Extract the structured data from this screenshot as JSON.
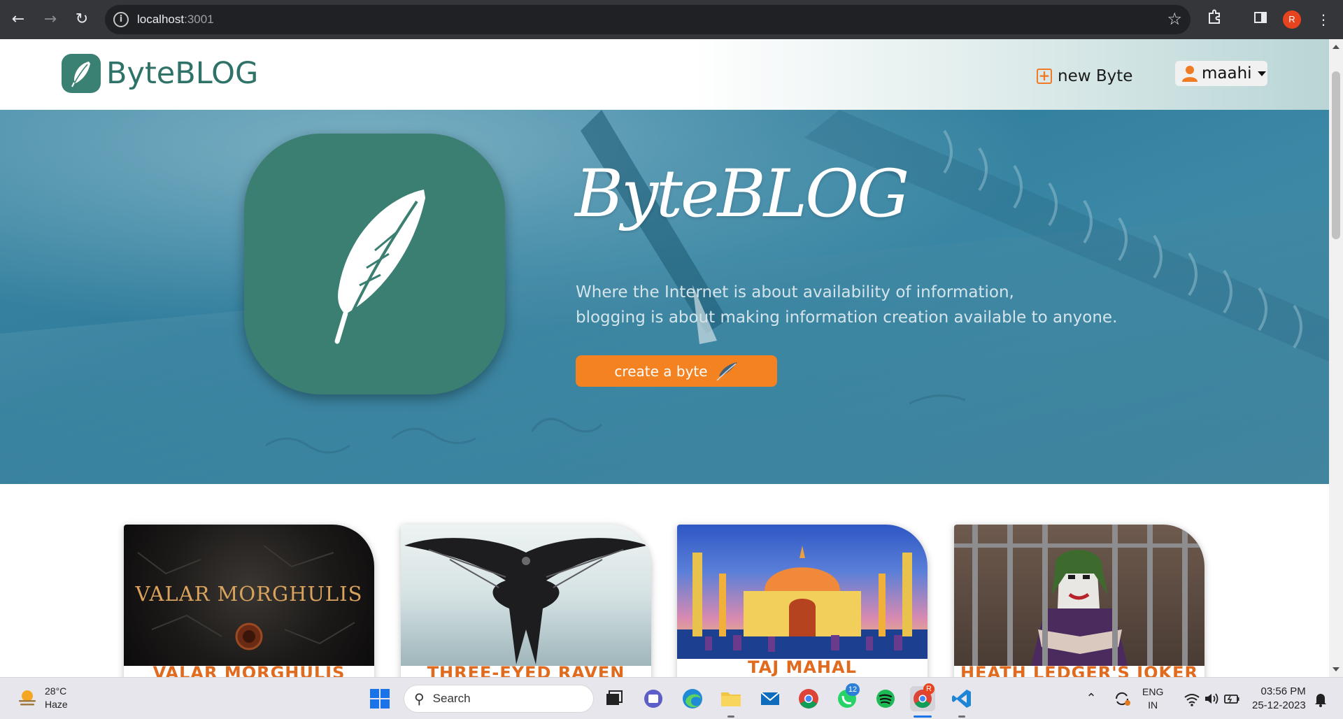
{
  "browser": {
    "url_host": "localhost",
    "url_port": ":3001",
    "profile_initial": "R"
  },
  "site": {
    "brand_name": "ByteBLOG",
    "nav_new_byte": "new Byte",
    "user_name": "maahi"
  },
  "hero": {
    "title": "ByteBLOG",
    "tagline_line1": "Where the Internet is about availability of information,",
    "tagline_line2": "blogging is about making information creation available to anyone.",
    "cta_label": "create a byte"
  },
  "cards": [
    {
      "image_text": "VALAR MORGHULIS",
      "title": "VALAR MORGHULIS"
    },
    {
      "image_text": "",
      "title": "THREE-EYED RAVEN"
    },
    {
      "image_text": "",
      "title": "TAJ MAHAL"
    },
    {
      "image_text": "",
      "title": "HEATH LEDGER'S JOKER"
    }
  ],
  "taskbar": {
    "weather_temp": "28°C",
    "weather_desc": "Haze",
    "search_placeholder": "Search",
    "whatsapp_badge": "12",
    "chrome_badge": "R",
    "lang_line1": "ENG",
    "lang_line2": "IN",
    "time": "03:56 PM",
    "date": "25-12-2023"
  },
  "colors": {
    "brand_green": "#3a8073",
    "accent_orange": "#f58220",
    "hero_blue": "#2f7d9c",
    "card_title": "#e06a1e"
  }
}
